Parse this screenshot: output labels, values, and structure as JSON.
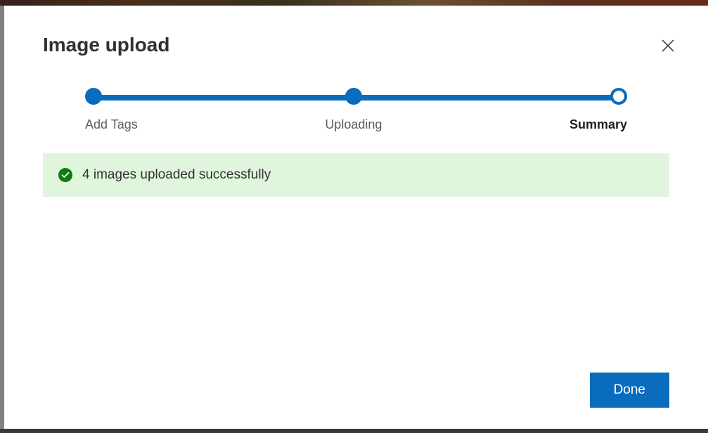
{
  "dialog": {
    "title": "Image upload"
  },
  "stepper": {
    "steps": [
      {
        "label": "Add Tags",
        "completed": true
      },
      {
        "label": "Uploading",
        "completed": true
      },
      {
        "label": "Summary",
        "active": true
      }
    ]
  },
  "status": {
    "message": "4 images uploaded successfully",
    "icon": "success-check"
  },
  "actions": {
    "done_label": "Done"
  }
}
